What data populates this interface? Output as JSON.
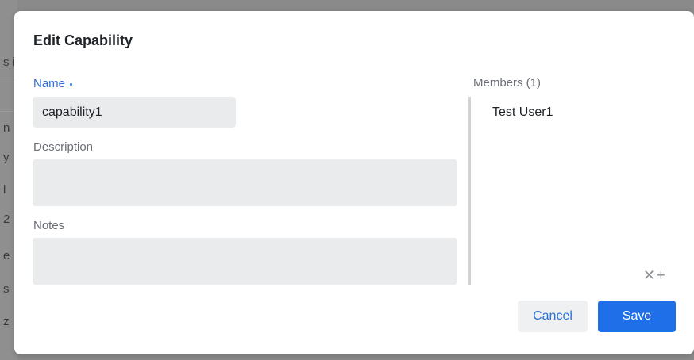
{
  "background": {
    "letters": [
      "s i",
      "n",
      "y",
      "l",
      "2",
      "e",
      "s",
      "z"
    ]
  },
  "dialog": {
    "title": "Edit Capability",
    "name": {
      "label": "Name",
      "value": "capability1"
    },
    "description": {
      "label": "Description",
      "value": ""
    },
    "notes": {
      "label": "Notes",
      "value": ""
    },
    "members": {
      "label": "Members (1)",
      "items": [
        "Test User1"
      ],
      "remove_icon": "close-icon",
      "add_icon": "plus-icon"
    },
    "buttons": {
      "cancel": "Cancel",
      "save": "Save"
    }
  },
  "colors": {
    "accent": "#1e6fe8",
    "input_bg": "#e9ebed",
    "required_label": "#2a6fd6"
  }
}
